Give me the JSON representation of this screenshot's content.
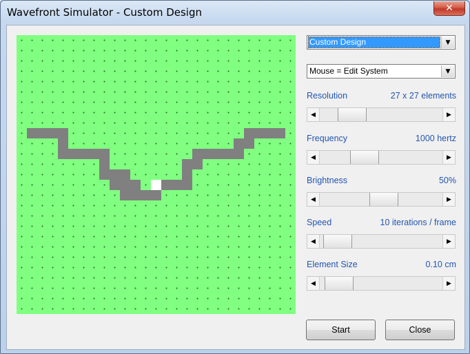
{
  "window": {
    "title": "Wavefront Simulator - Custom Design",
    "close_glyph": "✕"
  },
  "design_select": {
    "value": "Custom Design"
  },
  "mouse_mode_select": {
    "value": "Mouse = Edit System"
  },
  "controls": {
    "resolution": {
      "label": "Resolution",
      "value": "27 x 27 elements",
      "position": 0.19
    },
    "frequency": {
      "label": "Frequency",
      "value": "1000 hertz",
      "position": 0.32
    },
    "brightness": {
      "label": "Brightness",
      "value": "50%",
      "position": 0.53
    },
    "speed": {
      "label": "Speed",
      "value": "10 iterations / frame",
      "position": 0.04
    },
    "element_size": {
      "label": "Element Size",
      "value": "0.10 cm",
      "position": 0.05
    }
  },
  "buttons": {
    "start": "Start",
    "close": "Close"
  },
  "icons": {
    "arrow_left": "◀",
    "arrow_right": "▶",
    "arrow_down": "▼"
  },
  "grid": {
    "size": 27,
    "background_color": "#80ff80",
    "wall_color": "#808080",
    "source_color": "#ffffff",
    "wall_cells": [
      [
        9,
        1
      ],
      [
        9,
        2
      ],
      [
        9,
        3
      ],
      [
        9,
        4
      ],
      [
        10,
        4
      ],
      [
        11,
        4
      ],
      [
        11,
        5
      ],
      [
        11,
        6
      ],
      [
        11,
        7
      ],
      [
        11,
        8
      ],
      [
        12,
        8
      ],
      [
        13,
        8
      ],
      [
        13,
        9
      ],
      [
        13,
        10
      ],
      [
        14,
        9
      ],
      [
        14,
        10
      ],
      [
        14,
        11
      ],
      [
        15,
        10
      ],
      [
        15,
        11
      ],
      [
        15,
        12
      ],
      [
        15,
        13
      ],
      [
        14,
        14
      ],
      [
        14,
        15
      ],
      [
        14,
        16
      ],
      [
        13,
        16
      ],
      [
        12,
        16
      ],
      [
        12,
        17
      ],
      [
        11,
        17
      ],
      [
        11,
        18
      ],
      [
        11,
        19
      ],
      [
        11,
        20
      ],
      [
        11,
        21
      ],
      [
        10,
        21
      ],
      [
        10,
        22
      ],
      [
        9,
        22
      ],
      [
        9,
        23
      ],
      [
        9,
        24
      ],
      [
        9,
        25
      ]
    ],
    "source_cells": [
      [
        14,
        13
      ]
    ]
  }
}
